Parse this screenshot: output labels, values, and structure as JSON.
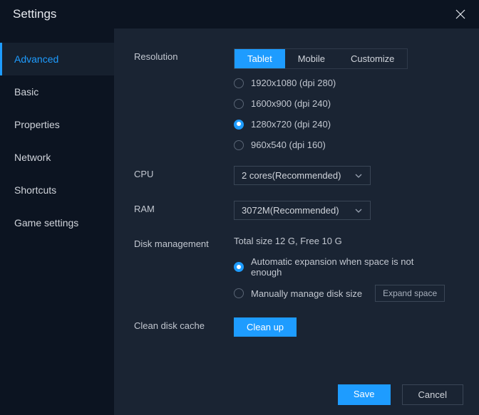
{
  "title": "Settings",
  "sidebar": {
    "items": [
      {
        "label": "Advanced",
        "active": true
      },
      {
        "label": "Basic"
      },
      {
        "label": "Properties"
      },
      {
        "label": "Network"
      },
      {
        "label": "Shortcuts"
      },
      {
        "label": "Game settings"
      }
    ]
  },
  "resolution": {
    "label": "Resolution",
    "tabs": [
      {
        "label": "Tablet",
        "active": true
      },
      {
        "label": "Mobile"
      },
      {
        "label": "Customize"
      }
    ],
    "options": [
      {
        "label": "1920x1080  (dpi 280)",
        "checked": false
      },
      {
        "label": "1600x900  (dpi 240)",
        "checked": false
      },
      {
        "label": "1280x720  (dpi 240)",
        "checked": true
      },
      {
        "label": "960x540  (dpi 160)",
        "checked": false
      }
    ]
  },
  "cpu": {
    "label": "CPU",
    "value": "2 cores(Recommended)"
  },
  "ram": {
    "label": "RAM",
    "value": "3072M(Recommended)"
  },
  "disk": {
    "label": "Disk management",
    "status": "Total size 12 G,  Free 10 G",
    "options": [
      {
        "label": "Automatic expansion when space is not enough",
        "checked": true
      },
      {
        "label": "Manually manage disk size",
        "checked": false
      }
    ],
    "expand_label": "Expand space"
  },
  "clean": {
    "label": "Clean disk cache",
    "button": "Clean up"
  },
  "footer": {
    "save": "Save",
    "cancel": "Cancel"
  }
}
